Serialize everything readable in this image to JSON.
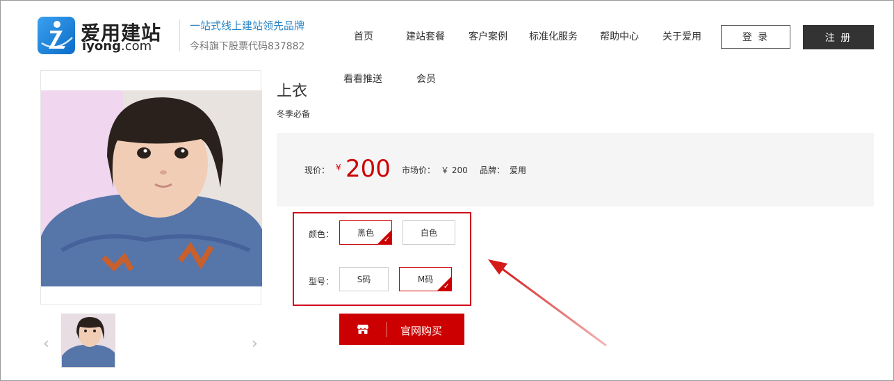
{
  "brand": {
    "name_cn": "爱用建站",
    "name_en_bold": "iyong",
    "name_en_rest": ".com",
    "slogan": "一站式线上建站领先品牌",
    "stock": "今科旗下股票代码837882"
  },
  "nav": {
    "items": [
      "首页",
      "建站套餐",
      "客户案例",
      "标准化服务",
      "帮助中心",
      "关于爱用"
    ],
    "login": "登 录",
    "register": "注 册"
  },
  "subnav": [
    "看看推送",
    "会员"
  ],
  "product": {
    "title": "上衣",
    "subtitle": "冬季必备",
    "price_label": "现价：",
    "currency": "¥",
    "price": "200",
    "market_label": "市场价：",
    "market_price": "￥ 200",
    "brand_label": "品牌：",
    "brand_value": "爱用"
  },
  "options": {
    "color_label": "颜色：",
    "colors": [
      "黑色",
      "白色"
    ],
    "color_selected": "黑色",
    "size_label": "型号：",
    "sizes": [
      "S码",
      "M码"
    ],
    "size_selected": "M码"
  },
  "buy_button": "官网购买",
  "colors": {
    "accent": "#cc0000",
    "brand_blue": "#2b84c6",
    "dark": "#333333"
  }
}
